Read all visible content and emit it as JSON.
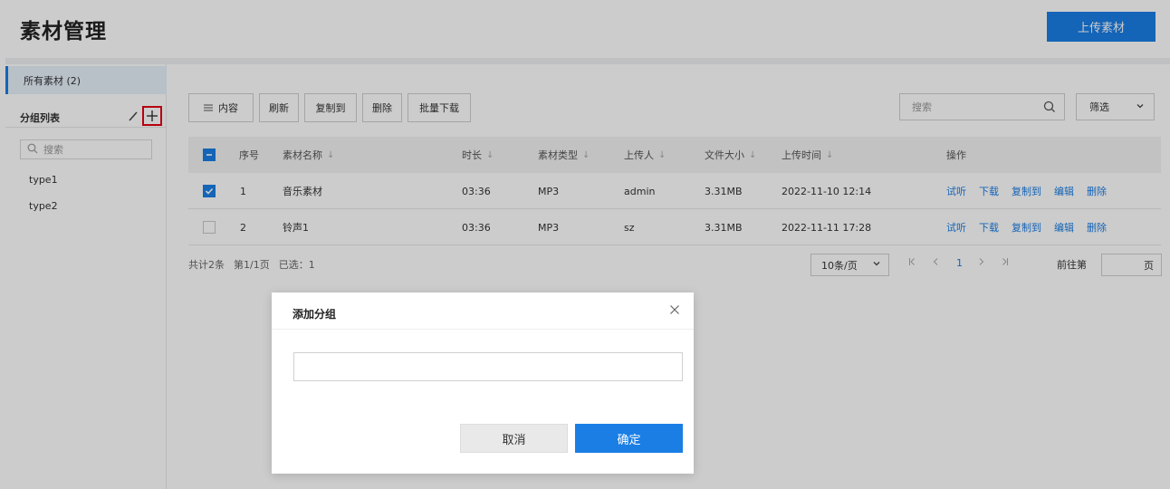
{
  "header": {
    "title": "素材管理",
    "upload_label": "上传素材"
  },
  "sidebar": {
    "all_label": "所有素材 (2)",
    "group_list_label": "分组列表",
    "search_placeholder": "搜索",
    "groups": [
      "type1",
      "type2"
    ]
  },
  "toolbar": {
    "content_label": "内容",
    "refresh_label": "刷新",
    "copy_to_label": "复制到",
    "delete_label": "删除",
    "batch_download_label": "批量下载",
    "search_placeholder": "搜索",
    "filter_label": "筛选"
  },
  "table": {
    "columns": [
      "序号",
      "素材名称",
      "时长",
      "素材类型",
      "上传人",
      "文件大小",
      "上传时间",
      "操作"
    ],
    "rows": [
      {
        "index": "1",
        "name": "音乐素材",
        "duration": "03:36",
        "type": "MP3",
        "uploader": "admin",
        "size": "3.31MB",
        "time": "2022-11-10 12:14",
        "checked": true
      },
      {
        "index": "2",
        "name": "铃声1",
        "duration": "03:36",
        "type": "MP3",
        "uploader": "sz",
        "size": "3.31MB",
        "time": "2022-11-11 17:28",
        "checked": false
      }
    ],
    "actions": [
      "试听",
      "下载",
      "复制到",
      "编辑",
      "删除"
    ]
  },
  "pagination": {
    "total": "共计2条",
    "page_info": "第1/1页",
    "selected": "已选：1",
    "page_size": "10条/页",
    "current_page": "1",
    "goto_label": "前往第",
    "goto_suffix": "页"
  },
  "modal": {
    "title": "添加分组",
    "input_value": "",
    "cancel_label": "取消",
    "ok_label": "确定"
  },
  "colors": {
    "primary": "#1a7ee5",
    "highlight": "#e60012"
  }
}
